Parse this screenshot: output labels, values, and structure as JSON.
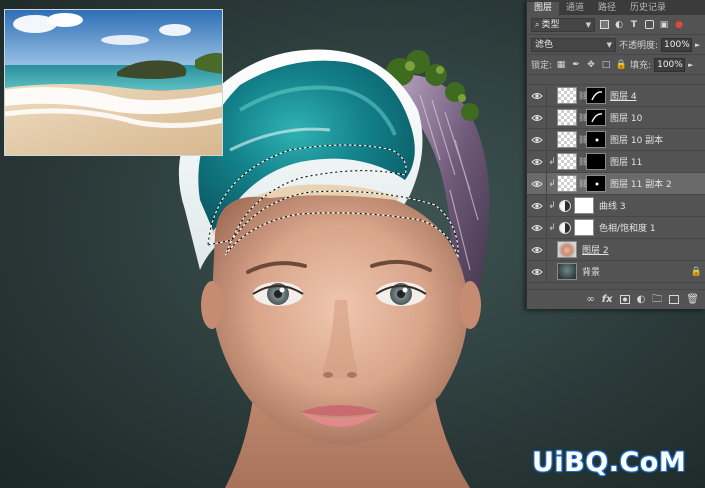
{
  "panel": {
    "tabs": [
      "图层",
      "通道",
      "路径",
      "历史记录"
    ],
    "filter": {
      "kind_label": "类型"
    },
    "blend": {
      "mode": "滤色",
      "opacity_label": "不透明度:",
      "opacity_value": "100%"
    },
    "lock": {
      "label": "锁定:",
      "fill_label": "填充:",
      "fill_value": "100%"
    },
    "layers": [
      {
        "name": "图层 4",
        "thumb": "transparent",
        "mask": "curl",
        "clip": false,
        "kind": "pixel",
        "underline": true,
        "selected": false
      },
      {
        "name": "图层 10",
        "thumb": "transparent",
        "mask": "curl",
        "clip": false,
        "kind": "pixel",
        "underline": false,
        "selected": false
      },
      {
        "name": "图层 10 副本",
        "thumb": "transparent",
        "mask": "dot",
        "clip": false,
        "kind": "pixel",
        "underline": false,
        "selected": false
      },
      {
        "name": "图层 11",
        "thumb": "transparent",
        "mask": "black",
        "clip": true,
        "kind": "pixel",
        "underline": false,
        "selected": false
      },
      {
        "name": "图层 11 副本 2",
        "thumb": "transparent",
        "mask": "dot",
        "clip": true,
        "kind": "pixel",
        "underline": false,
        "selected": true
      },
      {
        "name": "曲线 3",
        "thumb": "white",
        "clip": true,
        "kind": "adjustment",
        "underline": false,
        "selected": false
      },
      {
        "name": "色相/饱和度 1",
        "thumb": "white",
        "clip": true,
        "kind": "adjustment",
        "underline": false,
        "selected": false
      },
      {
        "name": "图层 2",
        "thumb": "face",
        "clip": false,
        "kind": "pixel",
        "underline": true,
        "selected": false
      },
      {
        "name": "背景",
        "thumb": "dark-bg",
        "clip": false,
        "kind": "background",
        "underline": false,
        "selected": false
      }
    ],
    "footer_icons": [
      "link-icon",
      "fx-icon",
      "mask-icon",
      "adjustment-icon",
      "folder-icon",
      "new-layer-icon",
      "trash-icon"
    ]
  },
  "watermark": "UiBQ.CoM",
  "colors": {
    "panel_bg": "#535353",
    "selected_row": "#6a6a6a",
    "watermark_stroke": "#1b6fd1",
    "backdrop": "#2b3b3a",
    "wave_teal": "#1f8f93"
  }
}
